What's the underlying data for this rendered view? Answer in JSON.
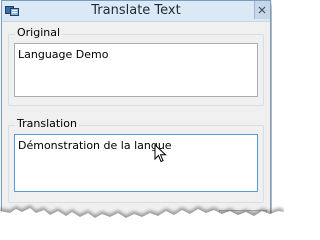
{
  "window": {
    "title": "Translate Text",
    "icon": "app-icon",
    "close_icon": "close-icon"
  },
  "original": {
    "label": "Original",
    "value": "Language Demo"
  },
  "translation": {
    "label": "Translation",
    "value": "Démonstration de la langue"
  },
  "colors": {
    "titlebar": "#dbe8f5",
    "dialog_bg": "#f0f0f0",
    "focus_border": "#5b9bd5"
  }
}
